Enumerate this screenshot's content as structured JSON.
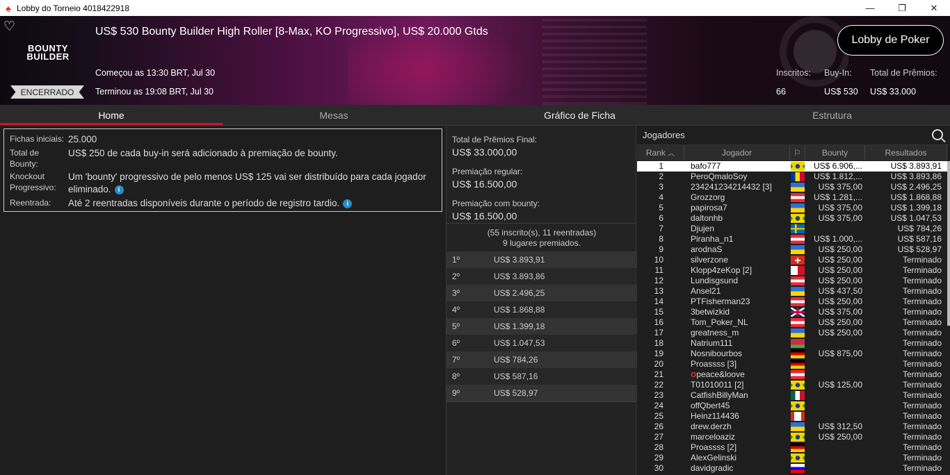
{
  "window": {
    "title": "Lobby do Torneio 4018422918"
  },
  "header": {
    "tourney_title": "US$ 530 Bounty Builder High Roller [8-Max, KO Progressivo], US$ 20.000 Gtds",
    "logo_line1": "BOUNTY",
    "logo_line2": "BUILDER",
    "status_badge": "ENCERRADO",
    "started": "Começou as 13:30 BRT, Jul 30",
    "finished": "Terminou as 19:08 BRT, Jul 30",
    "lobby_button": "Lobby de Poker",
    "entrants_label": "Inscritos:",
    "entrants_value": "66",
    "buyin_label": "Buy-In:",
    "buyin_value": "US$ 530",
    "prizepool_label": "Total de Prêmios:",
    "prizepool_value": "US$ 33.000"
  },
  "tabs": [
    "Home",
    "Mesas",
    "Gráfico de Ficha",
    "Estrutura"
  ],
  "info": [
    {
      "label": "Fichas iniciais:",
      "value": "25.000"
    },
    {
      "label": "Total de Bounty:",
      "value": "US$ 250 de cada buy-in será adicionado à premiação de bounty."
    },
    {
      "label": "Knockout Progressivo:",
      "value": "Um 'bounty' progressivo de pelo menos US$ 125 vai ser distribuído para cada jogador eliminado."
    },
    {
      "label": "Reentrada:",
      "value": "Até 2 reentradas disponíveis durante o período de registro tardio."
    }
  ],
  "prizes": {
    "final_label": "Total de Prêmios Final:",
    "final_value": "US$ 33.000,00",
    "regular_label": "Premiação regular:",
    "regular_value": "US$ 16.500,00",
    "bounty_label": "Premiação com bounty:",
    "bounty_value": "US$ 16.500,00",
    "entrants_line": "(55 inscrito(s), 11 reentradas)",
    "paid_line": "9 lugares premiados.",
    "places": [
      {
        "pos": "1º",
        "amount": "US$ 3.893,91"
      },
      {
        "pos": "2º",
        "amount": "US$ 3.893,86"
      },
      {
        "pos": "3º",
        "amount": "US$ 2.496,25"
      },
      {
        "pos": "4º",
        "amount": "US$ 1.868,88"
      },
      {
        "pos": "5º",
        "amount": "US$ 1.399,18"
      },
      {
        "pos": "6º",
        "amount": "US$ 1.047,53"
      },
      {
        "pos": "7º",
        "amount": "US$ 784,26"
      },
      {
        "pos": "8º",
        "amount": "US$ 587,16"
      },
      {
        "pos": "9º",
        "amount": "US$ 528,97"
      }
    ]
  },
  "players": {
    "title": "Jogadores",
    "columns": {
      "rank": "Rank",
      "player": "Jogador",
      "bounty": "Bounty",
      "result": "Resultados"
    },
    "rows": [
      {
        "rank": "1",
        "name": "bafo777",
        "flag": "br",
        "bounty": "US$ 6.906,...",
        "result": "US$ 3.893,91"
      },
      {
        "rank": "2",
        "name": "PeroQmaloSoy",
        "flag": "ad",
        "bounty": "US$ 1.812,...",
        "result": "US$ 3.893,86"
      },
      {
        "rank": "3",
        "name": "234241234214432 [3]",
        "flag": "ua",
        "bounty": "US$ 375,00",
        "result": "US$ 2.496,25"
      },
      {
        "rank": "4",
        "name": "Grozzorg",
        "flag": "at",
        "bounty": "US$ 1.281,...",
        "result": "US$ 1.868,88"
      },
      {
        "rank": "5",
        "name": "papirosa7",
        "flag": "ua",
        "bounty": "US$ 375,00",
        "result": "US$ 1.399,18"
      },
      {
        "rank": "6",
        "name": "daltonhb",
        "flag": "br",
        "bounty": "US$ 375,00",
        "result": "US$ 1.047,53"
      },
      {
        "rank": "7",
        "name": "Djujen",
        "flag": "se",
        "bounty": "",
        "result": "US$ 784,26"
      },
      {
        "rank": "8",
        "name": "Piranha_n1",
        "flag": "at",
        "bounty": "US$ 1.000,...",
        "result": "US$ 587,16"
      },
      {
        "rank": "9",
        "name": "arodnaS",
        "flag": "ua",
        "bounty": "US$ 250,00",
        "result": "US$ 528,97"
      },
      {
        "rank": "10",
        "name": "silverzone",
        "flag": "ch",
        "bounty": "US$ 250,00",
        "result": "Terminado"
      },
      {
        "rank": "11",
        "name": "Klopp4zeKop [2]",
        "flag": "mt",
        "bounty": "US$ 250,00",
        "result": "Terminado"
      },
      {
        "rank": "12",
        "name": "Lundisgsund",
        "flag": "at",
        "bounty": "US$ 250,00",
        "result": "Terminado"
      },
      {
        "rank": "13",
        "name": "Ansel21",
        "flag": "ua",
        "bounty": "US$ 437,50",
        "result": "Terminado"
      },
      {
        "rank": "14",
        "name": "PTFisherman23",
        "flag": "at",
        "bounty": "US$ 250,00",
        "result": "Terminado"
      },
      {
        "rank": "15",
        "name": "3betwizkid",
        "flag": "gb",
        "bounty": "US$ 375,00",
        "result": "Terminado"
      },
      {
        "rank": "16",
        "name": "Tom_Poker_NL",
        "flag": "at",
        "bounty": "US$ 250,00",
        "result": "Terminado"
      },
      {
        "rank": "17",
        "name": "greatness_m",
        "flag": "ua",
        "bounty": "US$ 250,00",
        "result": "Terminado"
      },
      {
        "rank": "18",
        "name": "Natrium111",
        "flag": "by",
        "bounty": "",
        "result": "Terminado"
      },
      {
        "rank": "19",
        "name": "Nosnibourbos",
        "flag": "de",
        "bounty": "US$ 875,00",
        "result": "Terminado"
      },
      {
        "rank": "20",
        "name": "Proassss [3]",
        "flag": "de",
        "bounty": "",
        "result": "Terminado"
      },
      {
        "rank": "21",
        "name": "peace&loove",
        "flag": "at",
        "bounty": "",
        "result": "Terminado"
      },
      {
        "rank": "22",
        "name": "T01010011 [2]",
        "flag": "br",
        "bounty": "US$ 125,00",
        "result": "Terminado"
      },
      {
        "rank": "23",
        "name": "CatfishBillyMan",
        "flag": "mx",
        "bounty": "",
        "result": "Terminado"
      },
      {
        "rank": "24",
        "name": "offQbert45",
        "flag": "br",
        "bounty": "",
        "result": "Terminado"
      },
      {
        "rank": "25",
        "name": "Heinz114436",
        "flag": "ca",
        "bounty": "",
        "result": "Terminado"
      },
      {
        "rank": "26",
        "name": "drew.derzh",
        "flag": "ua",
        "bounty": "US$ 312,50",
        "result": "Terminado"
      },
      {
        "rank": "27",
        "name": "marceloaziz",
        "flag": "br",
        "bounty": "US$ 250,00",
        "result": "Terminado"
      },
      {
        "rank": "28",
        "name": "Proassss [2]",
        "flag": "de",
        "bounty": "",
        "result": "Terminado"
      },
      {
        "rank": "29",
        "name": "AlexGelinski",
        "flag": "br",
        "bounty": "",
        "result": "Terminado"
      },
      {
        "rank": "30",
        "name": "davidgradic",
        "flag": "si",
        "bounty": "",
        "result": "Terminado"
      }
    ]
  },
  "colors": {
    "accent": "#d0112b",
    "info_icon": "#2a8dc5"
  }
}
